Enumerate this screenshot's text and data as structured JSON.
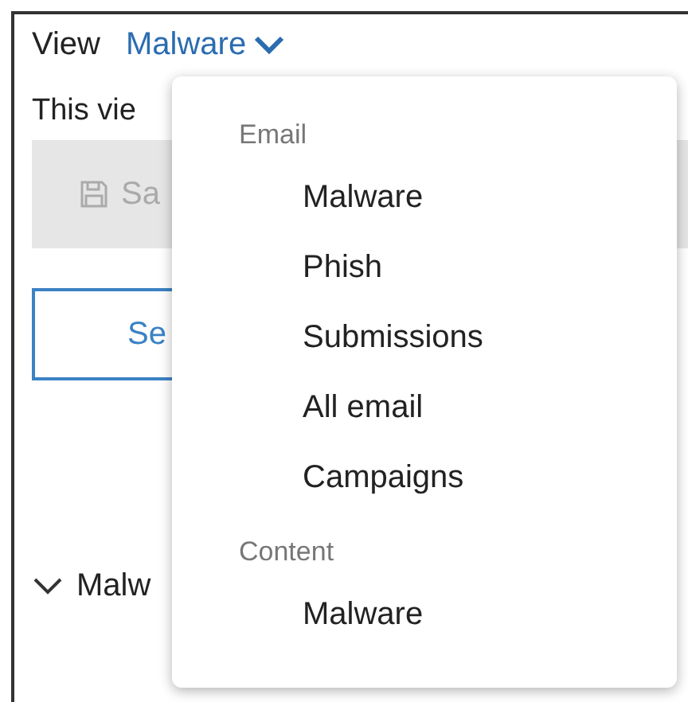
{
  "header": {
    "label": "View",
    "current_view": "Malware"
  },
  "description": {
    "left": "This vie"
  },
  "toolbar": {
    "left": "Sa"
  },
  "outlined_button": {
    "left": "Se"
  },
  "section": {
    "label": "Malw",
    "expanded": true
  },
  "dropdown": {
    "groups": [
      {
        "label": "Email",
        "items": [
          {
            "label": "Malware"
          },
          {
            "label": "Phish"
          },
          {
            "label": "Submissions"
          },
          {
            "label": "All email"
          },
          {
            "label": "Campaigns"
          }
        ]
      },
      {
        "label": "Content",
        "items": [
          {
            "label": "Malware"
          }
        ]
      }
    ]
  }
}
